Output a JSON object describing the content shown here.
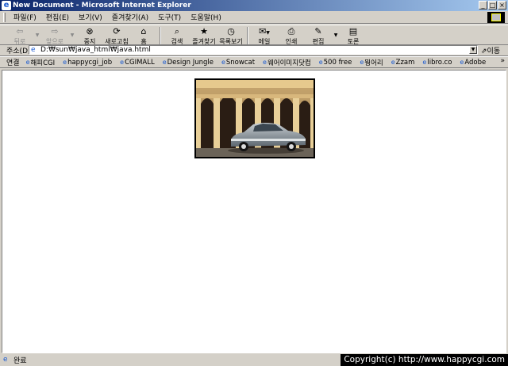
{
  "window": {
    "title": "New Document - Microsoft Internet Explorer"
  },
  "menu": [
    "파일(F)",
    "편집(E)",
    "보기(V)",
    "즐겨찾기(A)",
    "도구(T)",
    "도움말(H)"
  ],
  "toolbar": {
    "back": "뒤로",
    "forward": "앞으로",
    "stop": "중지",
    "refresh": "새로고침",
    "home": "홈",
    "search": "검색",
    "favorites": "즐겨찾기",
    "history": "목록보기",
    "mail": "메일",
    "print": "인쇄",
    "edit": "편집",
    "discuss": "토론"
  },
  "address": {
    "label": "주소(D)",
    "url": "D:₩sun₩java_html₩java.html",
    "go": "이동"
  },
  "links": {
    "label": "연결",
    "items": [
      "해피CGI",
      "happycgi_job",
      "CGIMALL",
      "Design Jungle",
      "Snowcat",
      "웨어이미지닷컴",
      "500 free",
      "뭥어리",
      "Zzam",
      "libro.co",
      "Adobe"
    ],
    "more": "»"
  },
  "status": {
    "text": "완료",
    "copyright": "Copyright(c) http://www.happycgi.com"
  }
}
